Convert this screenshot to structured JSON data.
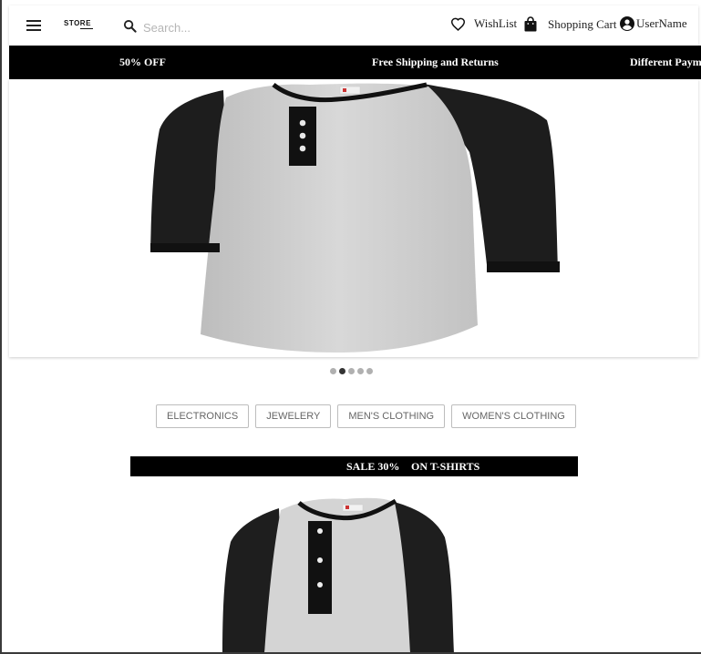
{
  "header": {
    "brand": "STORE",
    "search_placeholder": "Search...",
    "wishlist_label": "WishList",
    "cart_label": "Shopping Cart",
    "user_label": "UserName"
  },
  "promo": {
    "items": [
      "50% OFF",
      "Free Shipping and Returns",
      "Different Paym"
    ]
  },
  "carousel": {
    "active_index": 1,
    "count": 5
  },
  "categories": [
    "ELECTRONICS",
    "JEWELERY",
    "MEN'S CLOTHING",
    "WOMEN'S CLOTHING"
  ],
  "sale": {
    "left": "SALE 30%",
    "right": "ON T-SHIRTS"
  },
  "icons": {
    "menu": "menu-icon",
    "search": "search-icon",
    "wishlist": "heart-icon",
    "cart": "shopping-bag-icon",
    "user": "account-circle-icon"
  },
  "colors": {
    "promo_bg": "#000000",
    "sale_bg": "#000000",
    "chip_border": "#bdbdbd"
  }
}
